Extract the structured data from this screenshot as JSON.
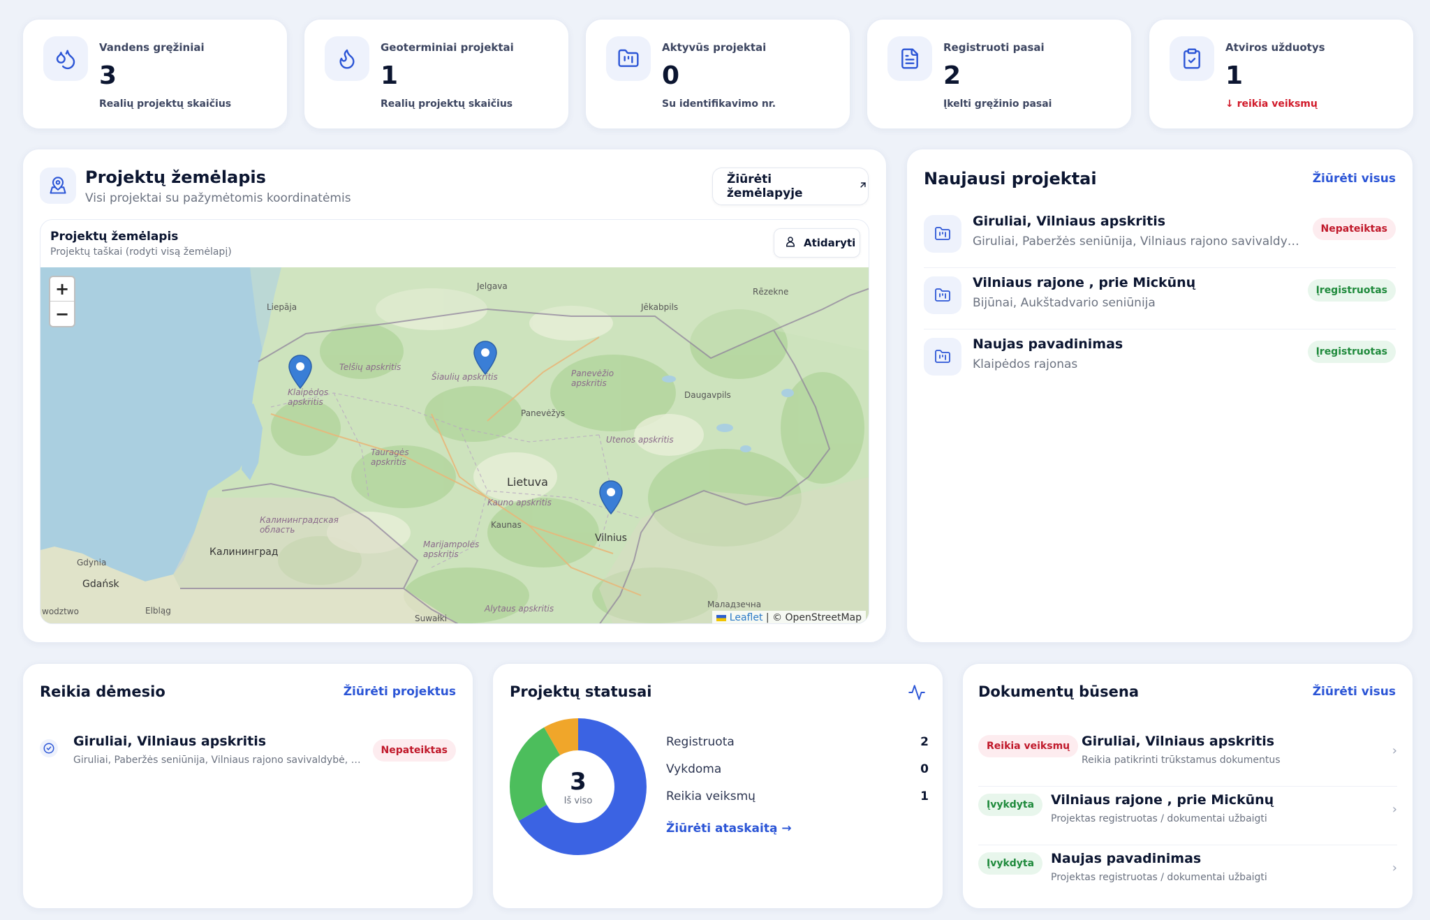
{
  "stats": [
    {
      "label": "Vandens gręžiniai",
      "value": "3",
      "sub": "Realių projektų skaičius",
      "icon": "water-drops-icon"
    },
    {
      "label": "Geoterminiai projektai",
      "value": "1",
      "sub": "Realių projektų skaičius",
      "icon": "flame-icon"
    },
    {
      "label": "Aktyvūs projektai",
      "value": "0",
      "sub": "Su identifikavimo nr.",
      "icon": "folder-chart-icon"
    },
    {
      "label": "Registruoti pasai",
      "value": "2",
      "sub": "Įkelti gręžinio pasai",
      "icon": "document-icon"
    },
    {
      "label": "Atviros užduotys",
      "value": "1",
      "sub": "↓ reikia veiksmų",
      "icon": "clipboard-check-icon"
    }
  ],
  "map_card": {
    "title": "Projektų žemėlapis",
    "subtitle": "Visi projektai su pažymėtomis koordinatėmis",
    "open_button": "Žiūrėti žemėlapyje",
    "inner_title": "Projektų žemėlapis",
    "inner_subtitle": "Projektų taškai (rodyti visą žemėlapį)",
    "inner_button": "Atidaryti",
    "zoom_in": "+",
    "zoom_out": "−",
    "attribution_leaflet": "Leaflet",
    "attribution_osm": " | © OpenStreetMap",
    "labels": {
      "jelgava": "Jelgava",
      "rezekne": "Rēzekne",
      "liepaja": "Liepāja",
      "jekabpils": "Jēkabpils",
      "telsiu": "Telšių apskritis",
      "siauliu": "Šiaulių apskritis",
      "panevezio": "Panevėžio apskritis",
      "daugavpils": "Daugavpils",
      "klaipedos": "Klaipėdos apskritis",
      "panevezys": "Panevėžys",
      "utenos": "Utenos apskritis",
      "taurages": "Tauragės apskritis",
      "lietuva": "Lietuva",
      "kauno": "Kauno apskritis",
      "kaunas": "Kaunas",
      "kaliningradskaya": "Калининградская область",
      "kaliningrad": "Калининград",
      "marijampoles": "Marijampolės apskritis",
      "vilnius": "Vilnius",
      "gdynia": "Gdynia",
      "gdansk": "Gdańsk",
      "elblag": "Elbląg",
      "suwalki": "Suwałki",
      "alytaus": "Alytaus apskritis",
      "maladzechna": "Маладзечна",
      "wodztwo": "wodztwo"
    }
  },
  "latest_projects": {
    "title": "Naujausi projektai",
    "view_all": "Žiūrėti visus",
    "items": [
      {
        "title": "Giruliai, Vilniaus apskritis",
        "sub": "Giruliai, Paberžės seniūnija, Vilniaus rajono savivaldybė, Vilniaus apskritis",
        "status": "Nepateiktas",
        "tone": "red"
      },
      {
        "title": "Vilniaus rajone , prie Mickūnų",
        "sub": "Bijūnai, Aukštadvario seniūnija",
        "status": "Įregistruotas",
        "tone": "green"
      },
      {
        "title": "Naujas pavadinimas",
        "sub": "Klaipėdos rajonas",
        "status": "Įregistruotas",
        "tone": "green"
      }
    ]
  },
  "attention": {
    "title": "Reikia dėmesio",
    "link": "Žiūrėti projektus",
    "items": [
      {
        "title": "Giruliai, Vilniaus apskritis",
        "sub": "Giruliai, Paberžės seniūnija, Vilniaus rajono savivaldybė, Vilniaus apskritis",
        "status": "Nepateiktas"
      }
    ]
  },
  "statuses": {
    "title": "Projektų statusai",
    "total": "3",
    "total_label": "Iš viso",
    "rows": [
      {
        "label": "Registruota",
        "value": "2"
      },
      {
        "label": "Vykdoma",
        "value": "0"
      },
      {
        "label": "Reikia veiksmų",
        "value": "1"
      }
    ],
    "report_link": "Žiūrėti ataskaitą →"
  },
  "chart_data": {
    "type": "pie",
    "categories": [
      "Registruota",
      "Vykdoma",
      "Reikia veiksmų"
    ],
    "values": [
      2,
      0,
      1
    ],
    "title": "Projektų statusai",
    "colors": [
      "#3b63e3",
      "#f0a62a",
      "#4cbe5c"
    ]
  },
  "documents": {
    "title": "Dokumentų būsena",
    "view_all": "Žiūrėti visus",
    "items": [
      {
        "badge": "Reikia veiksmų",
        "tone": "red",
        "title": "Giruliai, Vilniaus apskritis",
        "sub": "Reikia patikrinti trūkstamus dokumentus"
      },
      {
        "badge": "Įvykdyta",
        "tone": "green",
        "title": "Vilniaus rajone , prie Mickūnų",
        "sub": "Projektas registruotas / dokumentai užbaigti"
      },
      {
        "badge": "Įvykdyta",
        "tone": "green",
        "title": "Naujas pavadinimas",
        "sub": "Projektas registruotas / dokumentai užbaigti"
      }
    ]
  },
  "colors": {
    "accent": "#2b55d6",
    "danger": "#d11a2a",
    "success": "#1f8a3c",
    "bg": "#eef2f9"
  }
}
